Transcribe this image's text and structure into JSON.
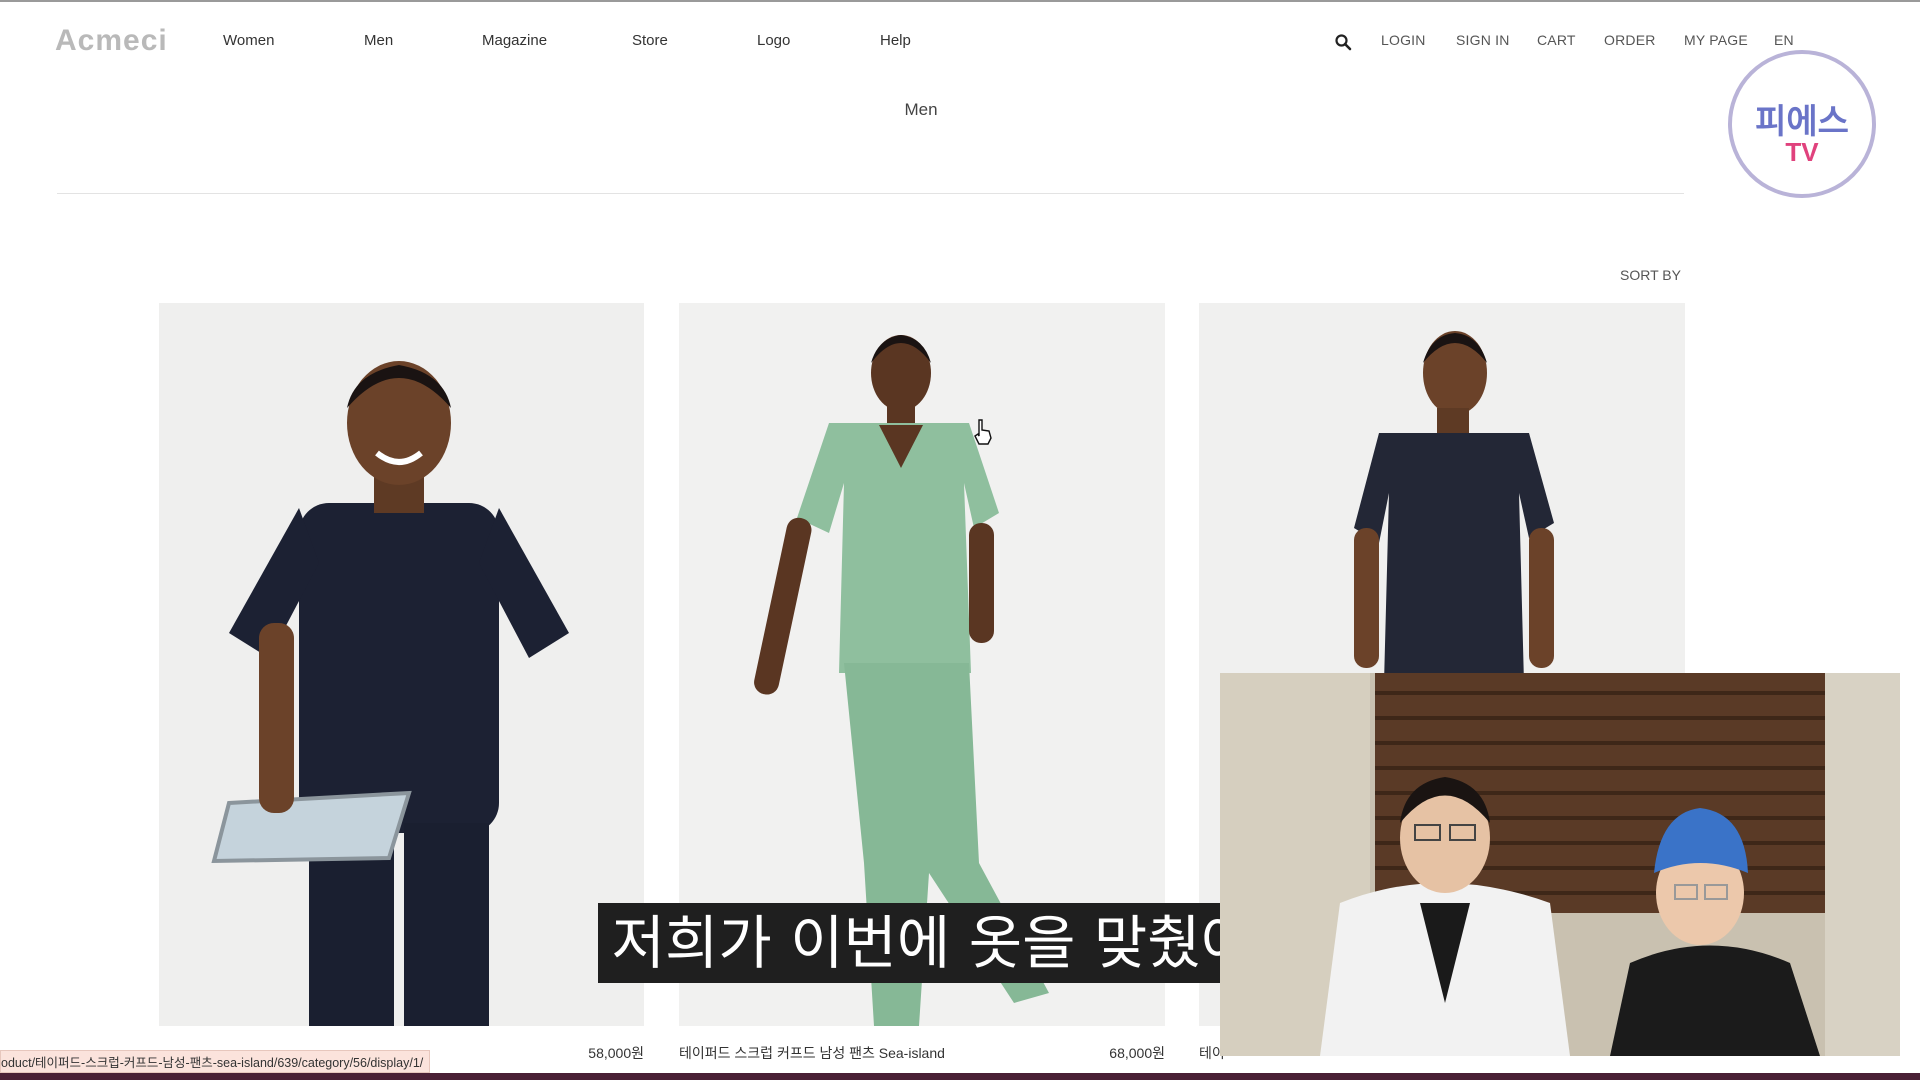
{
  "header": {
    "logo": "Acmeci",
    "nav": [
      "Women",
      "Men",
      "Magazine",
      "Store",
      "Logo",
      "Help"
    ],
    "right_nav": [
      "LOGIN",
      "SIGN IN",
      "CART",
      "ORDER",
      "MY PAGE",
      "EN"
    ],
    "search_icon": "search-icon"
  },
  "page": {
    "title": "Men",
    "sort_label": "SORT BY"
  },
  "products": [
    {
      "name": "…",
      "price": "58,000원",
      "shirt_color": "#1c2133",
      "pants_color": "#1a1f30"
    },
    {
      "name": "테이퍼드 스크럽 커프드 남성 팬츠 Sea-island",
      "price": "68,000원",
      "shirt_color": "#8fbf9e",
      "pants_color": "#86b896"
    },
    {
      "name": "테이",
      "price": "",
      "shirt_color": "#232736",
      "pants_color": "#232736"
    }
  ],
  "status_url": "oduct/테이퍼드-스크럽-커프드-남성-팬츠-sea-island/639/category/56/display/1/",
  "subtitle": "저희가 이번에 옷을 맞췄어요",
  "overlay_logo": {
    "top": "피에스",
    "bottom": "TV"
  },
  "colors": {
    "accent_bar": "#4a2035",
    "status_bg": "#fbe3dc",
    "logo_ring": "#b9b3d8"
  }
}
